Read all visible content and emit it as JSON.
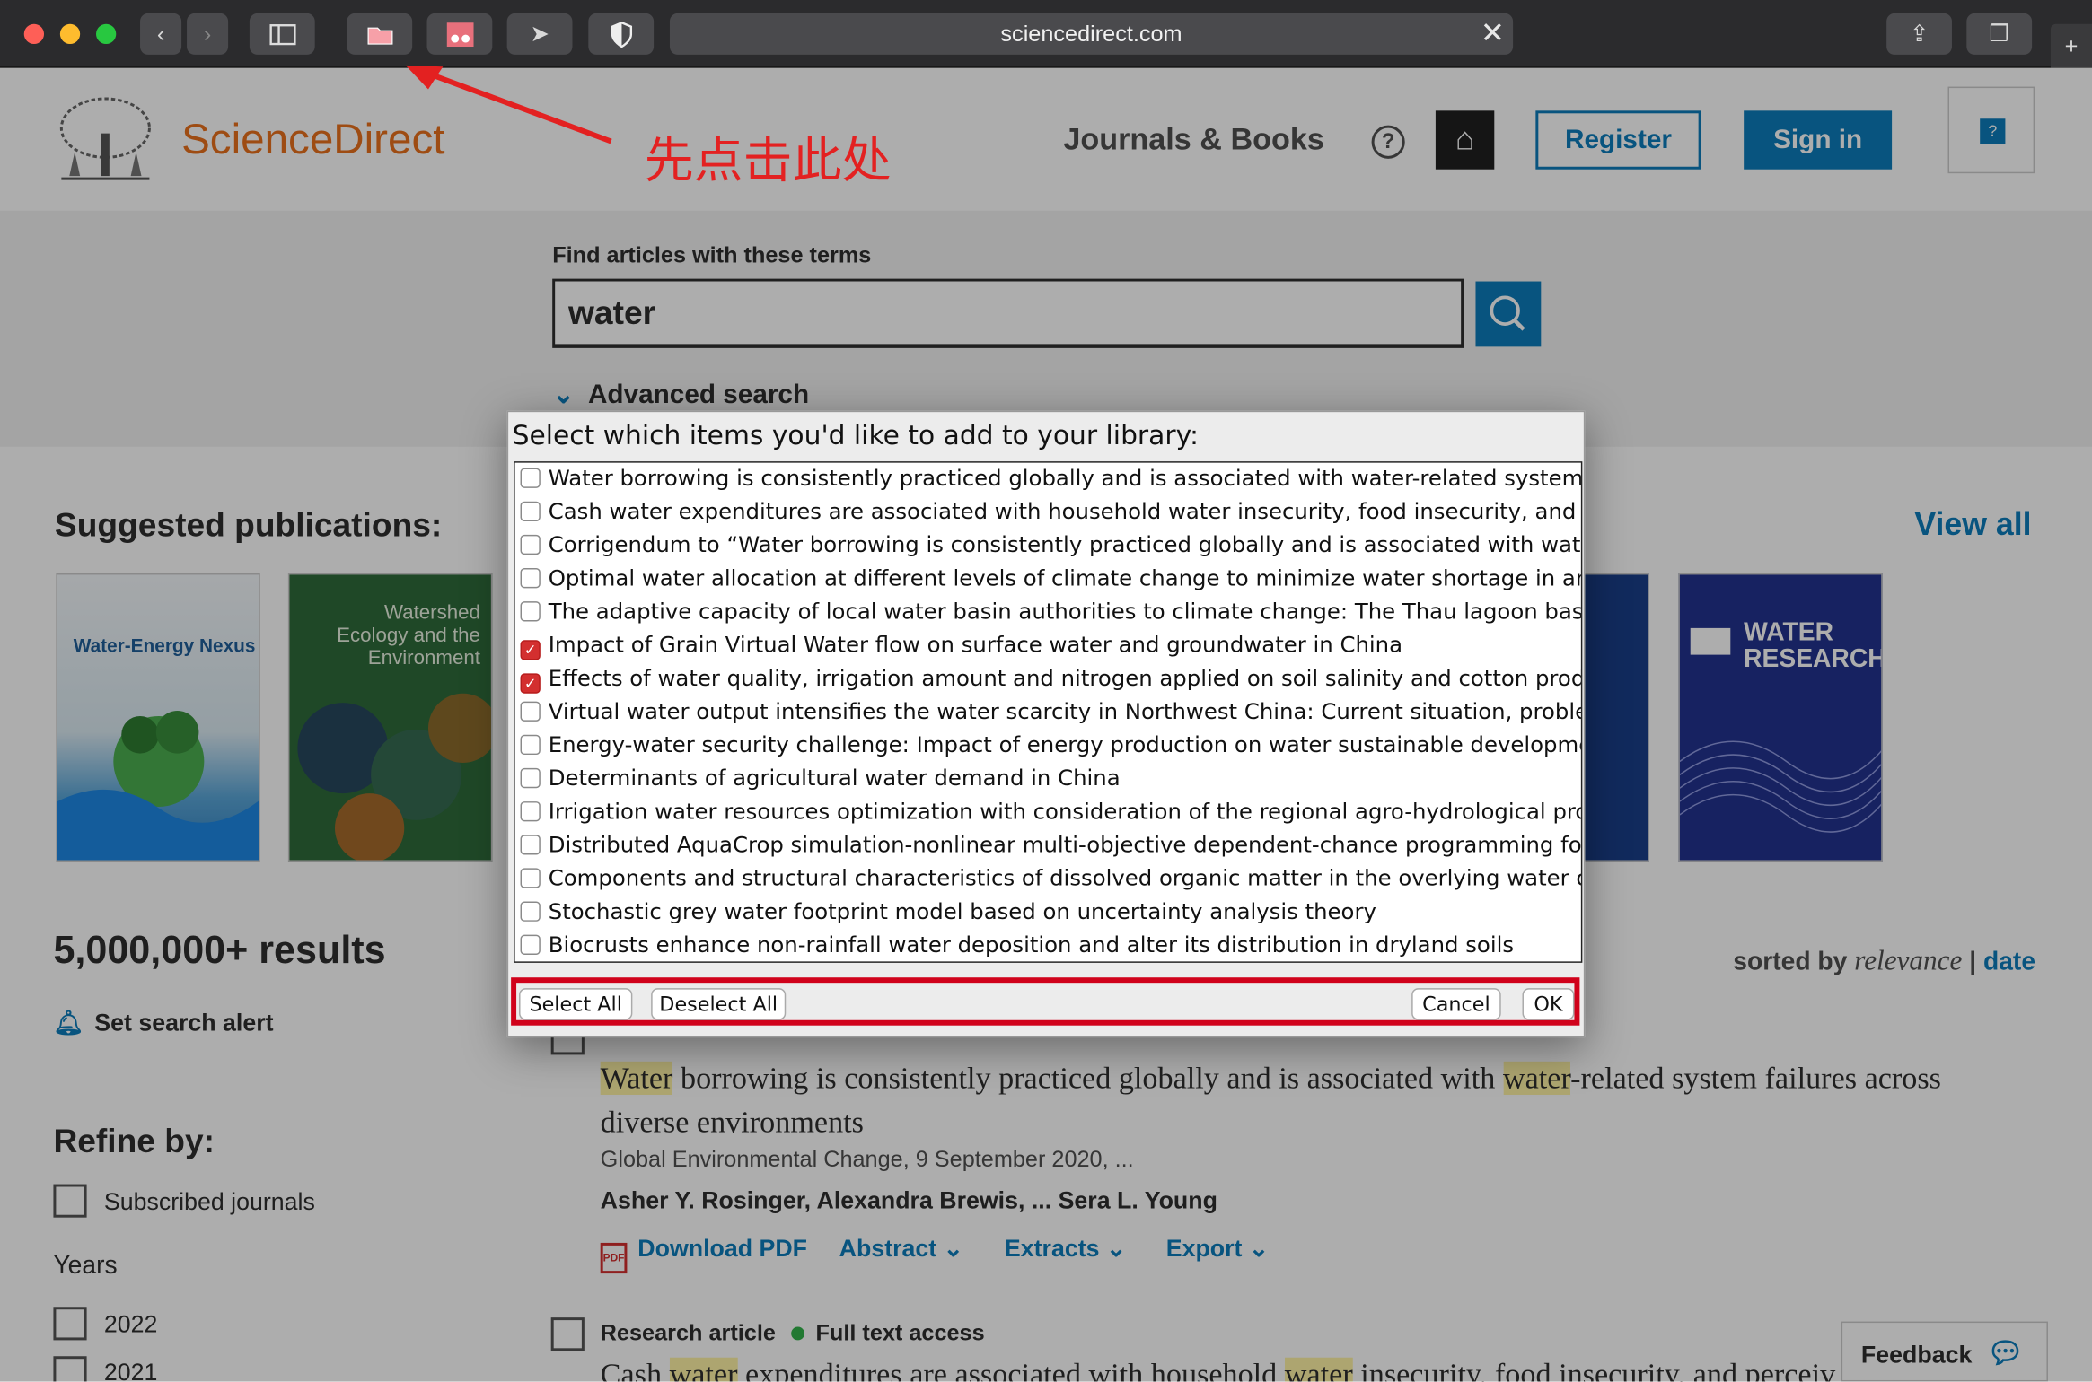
{
  "browser": {
    "url": "sciencedirect.com"
  },
  "header": {
    "brand": "ScienceDirect",
    "nav_journals": "Journals & Books",
    "help": "?",
    "register": "Register",
    "sign_in": "Sign in"
  },
  "annotation": {
    "text": "先点击此处"
  },
  "search": {
    "label": "Find articles with these terms",
    "value": "water",
    "advanced": "Advanced search"
  },
  "suggested": {
    "title": "Suggested publications:",
    "view_all": "View all",
    "covers": [
      "Water-Energy Nexus",
      "Watershed Ecology and the Environment",
      "WATER RESEARCH"
    ]
  },
  "results": {
    "count": "5,000,000+ results",
    "set_alert": "Set search alert",
    "sorted_by": "sorted by",
    "sort_relevance": "relevance",
    "sort_sep": "|",
    "sort_date": "date"
  },
  "refine": {
    "title": "Refine by:",
    "subscribed": "Subscribed journals",
    "years_label": "Years",
    "years": [
      "2022",
      "2021"
    ]
  },
  "article1": {
    "title_parts": [
      "Water",
      " borrowing is consistently practiced globally and is associated with ",
      "water",
      "-related system failures across diverse environments"
    ],
    "meta": "Global Environmental Change, 9 September 2020, ...",
    "authors": "Asher Y. Rosinger, Alexandra Brewis, ... Sera L. Young",
    "actions": [
      "Download PDF",
      "Abstract",
      "Extracts",
      "Export"
    ]
  },
  "article2": {
    "type": "Research article",
    "access": "Full text access",
    "title_parts": [
      "Cash ",
      "water",
      " expenditures are associated with household ",
      "water",
      " insecurity, food insecurity, and perceiv"
    ]
  },
  "feedback": "Feedback",
  "dialog": {
    "prompt": "Select which items you'd like to add to your library:",
    "items": [
      {
        "label": "Water borrowing is consistently practiced globally and is associated with water-related system failu",
        "checked": false
      },
      {
        "label": "Cash water expenditures are associated with household water insecurity, food insecurity, and perce",
        "checked": false
      },
      {
        "label": "Corrigendum to “Water borrowing is consistently practiced globally and is associated with water-re",
        "checked": false
      },
      {
        "label": "Optimal water allocation at different levels of climate change to minimize water shortage in arid re",
        "checked": false
      },
      {
        "label": "The adaptive capacity of local water basin authorities to climate change: The Thau lagoon basin in",
        "checked": false
      },
      {
        "label": "Impact of Grain Virtual Water flow on surface water and groundwater in China",
        "checked": true
      },
      {
        "label": "Effects of water quality, irrigation amount and nitrogen applied on soil salinity and cotton producti",
        "checked": true
      },
      {
        "label": "Virtual water output intensifies the water scarcity in Northwest China: Current situation, problem a",
        "checked": false
      },
      {
        "label": "Energy-water security challenge: Impact of energy production on water sustainable developments i",
        "checked": false
      },
      {
        "label": "Determinants of agricultural water demand in China",
        "checked": false
      },
      {
        "label": "Irrigation water resources optimization with consideration of the regional agro-hydrological proces",
        "checked": false
      },
      {
        "label": "Distributed AquaCrop simulation-nonlinear multi-objective dependent-chance programming for ir",
        "checked": false
      },
      {
        "label": "Components and structural characteristics of dissolved organic matter in the overlying water of the",
        "checked": false
      },
      {
        "label": "Stochastic grey water footprint model based on uncertainty analysis theory",
        "checked": false
      },
      {
        "label": "Biocrusts enhance non-rainfall water deposition and alter its distribution in dryland soils",
        "checked": false
      }
    ],
    "select_all": "Select All",
    "deselect_all": "Deselect All",
    "cancel": "Cancel",
    "ok": "OK"
  },
  "colors": {
    "brand_orange": "#e9711c",
    "link_blue": "#0c7dbb",
    "annotation_red": "#e32121",
    "highlight_box": "#d0021b"
  }
}
